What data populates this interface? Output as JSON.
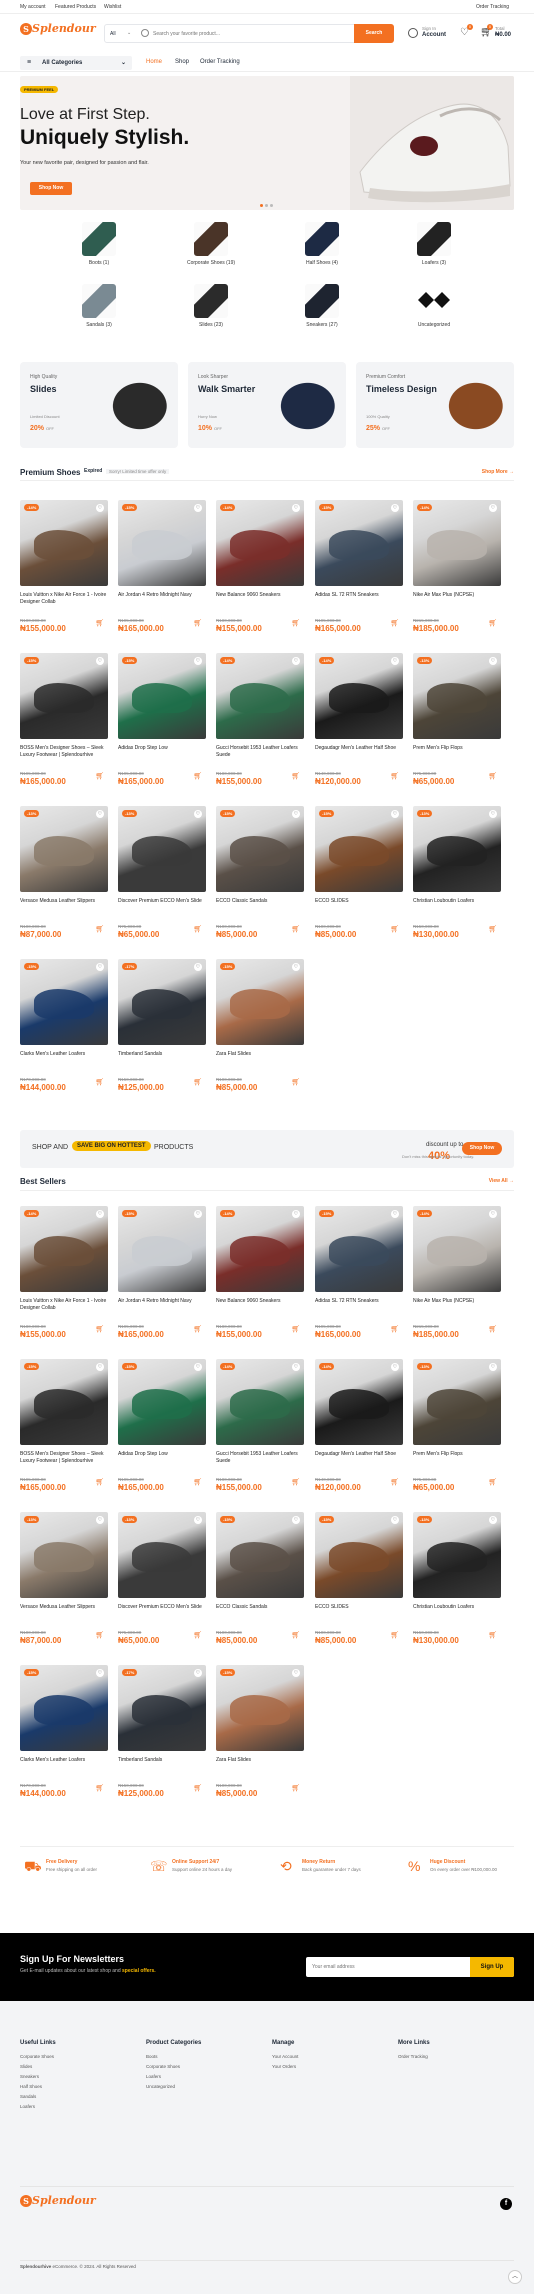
{
  "topbar": {
    "left_links": [
      "My account",
      "Featured Products",
      "Wishlist"
    ],
    "right_link": "Order Tracking"
  },
  "header": {
    "logo_text": "Splendour",
    "search_category": "All",
    "search_placeholder": "Search your favorite product...",
    "search_button": "Search",
    "account_top": "Sign In",
    "account_label": "Account",
    "wishlist_count": "0",
    "cart_count": "0",
    "cart_label": "Total",
    "cart_total": "₦0.00"
  },
  "nav": {
    "all_categories": "All Categories",
    "links": [
      "Home",
      "Shop",
      "Order Tracking"
    ]
  },
  "hero": {
    "badge": "PREMIUM FEEL",
    "line1": "Love at First Step.",
    "line2": "Uniquely Stylish.",
    "subtitle": "Your new favorite pair, designed for passion and flair.",
    "button": "Shop Now"
  },
  "categories": [
    {
      "label": "Boots (1)",
      "color": "#2f5d50"
    },
    {
      "label": "Corporate Shoes (19)",
      "color": "#4a3428"
    },
    {
      "label": "Half Shoes (4)",
      "color": "#1d2a44"
    },
    {
      "label": "Loafers (3)",
      "color": "#222222"
    },
    {
      "label": "Sandals (3)",
      "color": "#7a8a93"
    },
    {
      "label": "Slides (23)",
      "color": "#2b2b2b"
    },
    {
      "label": "Sneakers (27)",
      "color": "#1e2430"
    },
    {
      "label": "Uncategorized",
      "color": "#111111"
    }
  ],
  "promos": [
    {
      "t1": "High Quality",
      "t2": "Slides",
      "t3": "Limited Discount",
      "pct": "20%",
      "off": "OFF"
    },
    {
      "t1": "Look Sharper",
      "t2": "Walk Smarter",
      "t3": "Hurry Now",
      "pct": "10%",
      "off": "OFF"
    },
    {
      "t1": "Premium Comfort",
      "t2": "Timeless Design",
      "t3": "100% Quality",
      "pct": "25%",
      "off": "OFF"
    }
  ],
  "premium": {
    "title": "Premium Shoes",
    "expired_label": "Expired",
    "expired_note": "Sorry! Limited time offer only",
    "view_all": "Shop More →"
  },
  "products": [
    {
      "name": "Louis Vuitton x Nike Air Force 1 - Ivoire Designer Collab",
      "old": "₦180,000.00",
      "price": "₦155,000.00",
      "disc": "-14%",
      "color": "#6b4f3a"
    },
    {
      "name": "Air Jordan 4 Retro Midnight Navy",
      "old": "₦195,000.00",
      "price": "₦165,000.00",
      "disc": "-15%",
      "color": "#c9ccd1"
    },
    {
      "name": "New Balance 9060 Sneakers",
      "old": "₦180,000.00",
      "price": "₦155,000.00",
      "disc": "-14%",
      "color": "#7a2e2a"
    },
    {
      "name": "Adidas SL 72 RTN Sneakers",
      "old": "₦195,000.00",
      "price": "₦165,000.00",
      "disc": "-15%",
      "color": "#3b4a5c"
    },
    {
      "name": "Nike Air Max Plus (NCPSE)",
      "old": "₦215,000.00",
      "price": "₦185,000.00",
      "disc": "-14%",
      "color": "#b8b3ad"
    },
    {
      "name": "BOSS Men's Designer Shoes – Sleek Luxury Footwear | Splendourhive",
      "old": "₦195,000.00",
      "price": "₦165,000.00",
      "disc": "-15%",
      "color": "#2a2a2a"
    },
    {
      "name": "Adidas Drop Step Low",
      "old": "₦195,000.00",
      "price": "₦165,000.00",
      "disc": "-15%",
      "color": "#1f6f4a"
    },
    {
      "name": "Gucci Horsebit 1953 Leather Loafers Suede",
      "old": "₦180,000.00",
      "price": "₦155,000.00",
      "disc": "-14%",
      "color": "#2d6b4a"
    },
    {
      "name": "Degaudagr Men's Leather Half Shoe",
      "old": "₦140,000.00",
      "price": "₦120,000.00",
      "disc": "-14%",
      "color": "#1a1a1a"
    },
    {
      "name": "Prem Men's Flip Flops",
      "old": "₦75,000.00",
      "price": "₦65,000.00",
      "disc": "-13%",
      "color": "#4d4538"
    },
    {
      "name": "Versace Medusa Leather Slippers",
      "old": "₦100,000.00",
      "price": "₦87,000.00",
      "disc": "-13%",
      "color": "#8a7a6a"
    },
    {
      "name": "Discover Premium ECCO Men's Slide",
      "old": "₦75,000.00",
      "price": "₦65,000.00",
      "disc": "-13%",
      "color": "#3a3a3a"
    },
    {
      "name": "ECCO Classic Sandals",
      "old": "₦100,000.00",
      "price": "₦85,000.00",
      "disc": "-15%",
      "color": "#5a5048"
    },
    {
      "name": "ECCO SLIDES",
      "old": "₦100,000.00",
      "price": "₦85,000.00",
      "disc": "-15%",
      "color": "#7a4a2a"
    },
    {
      "name": "Christian Louboutin Loafers",
      "old": "₦150,000.00",
      "price": "₦130,000.00",
      "disc": "-13%",
      "color": "#222222"
    },
    {
      "name": "Clarks Men's Leather Loafers",
      "old": "₦170,000.00",
      "price": "₦144,000.00",
      "disc": "-15%",
      "color": "#1a3a6a"
    },
    {
      "name": "Timberland Sandals",
      "old": "₦150,000.00",
      "price": "₦125,000.00",
      "disc": "-17%",
      "color": "#2a3038"
    },
    {
      "name": "Zara Flat Slides",
      "old": "₦100,000.00",
      "price": "₦85,000.00",
      "disc": "-15%",
      "color": "#a86a48"
    }
  ],
  "banner": {
    "shop_and": "SHOP AND",
    "save": "SAVE BIG ON HOTTEST",
    "products": "PRODUCTS",
    "discount_label": "discount up to",
    "discount_pct": "40%",
    "discount_note": "Don't miss this special opportunity today.",
    "button": "Shop Now"
  },
  "bestsellers": {
    "title": "Best Sellers",
    "view_all": "View All →"
  },
  "features": [
    {
      "title": "Free Delivery",
      "sub": "Free shipping on all order"
    },
    {
      "title": "Online Support 24/7",
      "sub": "Support online 24 hours a day"
    },
    {
      "title": "Money Return",
      "sub": "Back guarantee under 7 days"
    },
    {
      "title": "Huge Discount",
      "sub": "On every order over ₦100,000.00"
    }
  ],
  "newsletter": {
    "title": "Sign Up For Newsletters",
    "sub": "Get E-mail updates about our latest shop and",
    "sub_hl": "special offers.",
    "placeholder": "Your email address",
    "button": "Sign Up"
  },
  "footer": {
    "cols": [
      {
        "title": "Useful Links",
        "items": [
          "Corporate Shoes",
          "Slides",
          "Sneakers",
          "Half Shoes",
          "Sandals",
          "Loafers"
        ]
      },
      {
        "title": "Product Categories",
        "items": [
          "Boots",
          "Corporate Shoes",
          "Loafers",
          "Uncategorized"
        ]
      },
      {
        "title": "Manage",
        "items": [
          "Your Account",
          "Your Orders"
        ]
      },
      {
        "title": "More Links",
        "items": [
          "Order Tracking"
        ]
      }
    ],
    "copyright_brand": "Splendourhive",
    "copyright": " eCommerce. © 2024. All Rights Reserved"
  },
  "colors": {
    "accent": "#f37021",
    "yellow": "#f5b800"
  }
}
